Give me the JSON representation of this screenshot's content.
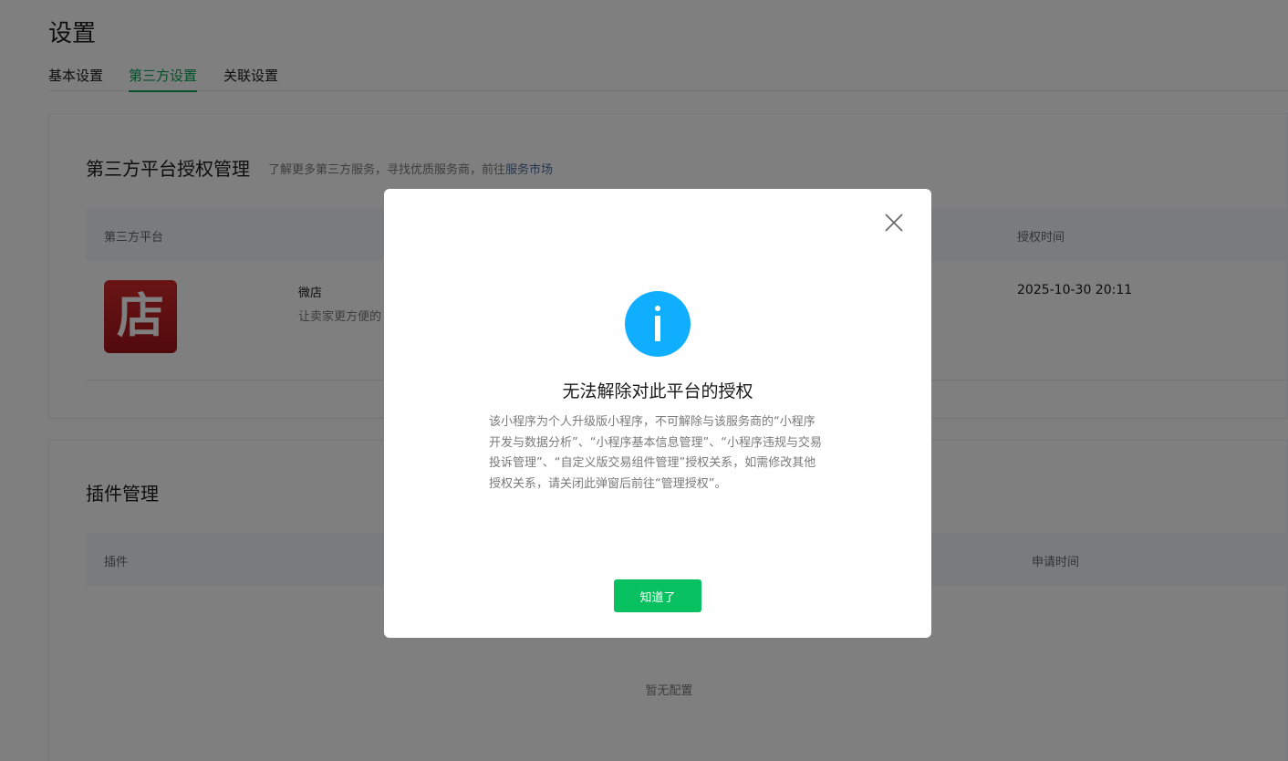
{
  "page": {
    "title": "设置",
    "tabs": [
      {
        "label": "基本设置",
        "active": false
      },
      {
        "label": "第三方设置",
        "active": true
      },
      {
        "label": "关联设置",
        "active": false
      }
    ]
  },
  "third_party": {
    "title": "第三方平台授权管理",
    "desc_prefix": "了解更多第三方服务，寻找优质服务商，前往",
    "desc_link": "服务市场",
    "columns": [
      "第三方平台",
      "授权时间"
    ],
    "rows": [
      {
        "logo_char": "店",
        "name": "微店",
        "desc": "让卖家更方便的",
        "auth_time": "2025-10-30 20:11"
      }
    ]
  },
  "plugins": {
    "title": "插件管理",
    "columns": [
      "插件",
      "申请时间"
    ],
    "empty_text": "暂无配置"
  },
  "dialog": {
    "title": "无法解除对此平台的授权",
    "body": "该小程序为个人升级版小程序，不可解除与该服务商的“小程序开发与数据分析”、“小程序基本信息管理”、“小程序违规与交易投诉管理”、“自定义版交易组件管理”授权关系，如需修改其他授权关系，请关闭此弹窗后前往“管理授权”。",
    "ok_label": "知道了",
    "icon": "info-icon",
    "icon_color": "#10aeff",
    "button_color": "#07c160"
  },
  "colors": {
    "accent": "#07a152",
    "link": "#4d6b9a"
  }
}
